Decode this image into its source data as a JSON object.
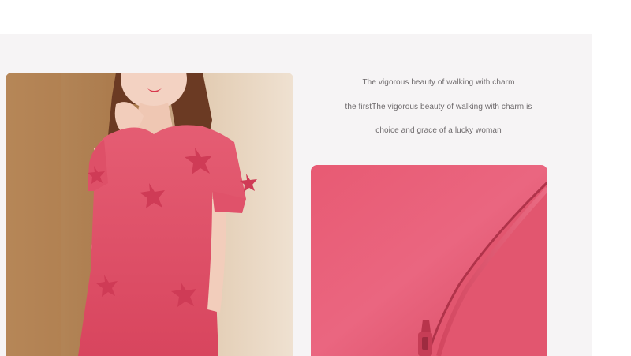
{
  "product_copy": {
    "line1": "The vigorous beauty of walking with charm",
    "line2": "the firstThe vigorous beauty of walking with charm is",
    "line3": "choice and grace of a lucky woman"
  },
  "images": {
    "model_photo": "model-in-pink-dress-photo",
    "fabric_detail": "pink-fabric-zipper-detail-photo"
  },
  "colors": {
    "background": "#f6f4f5",
    "dress_pink": "#e4586f",
    "text_gray": "#6e6a6c"
  }
}
